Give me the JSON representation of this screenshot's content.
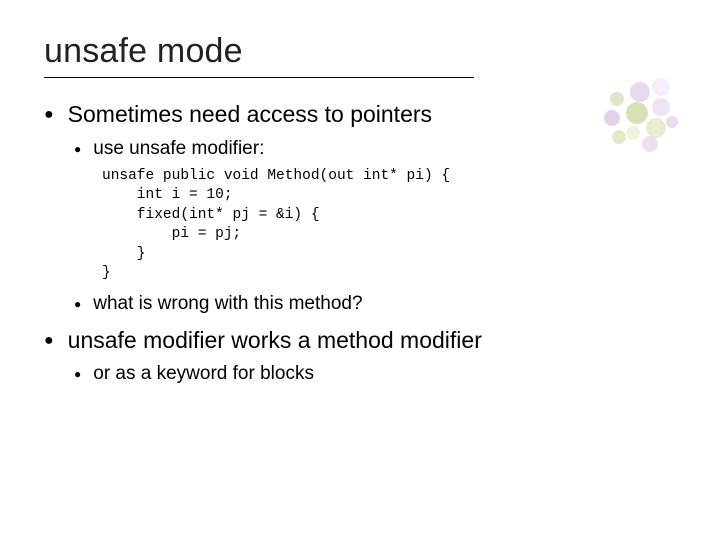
{
  "title": "unsafe mode",
  "bullets": {
    "b1": "Sometimes need access to pointers",
    "b1_1": "use unsafe modifier:",
    "code": "unsafe public void Method(out int* pi) {\n    int i = 10;\n    fixed(int* pj = &i) {\n        pi = pj;\n    }\n}",
    "b1_2": "what is wrong with this method?",
    "b2": "unsafe modifier works a method modifier",
    "b2_1": "or as a keyword for blocks"
  }
}
